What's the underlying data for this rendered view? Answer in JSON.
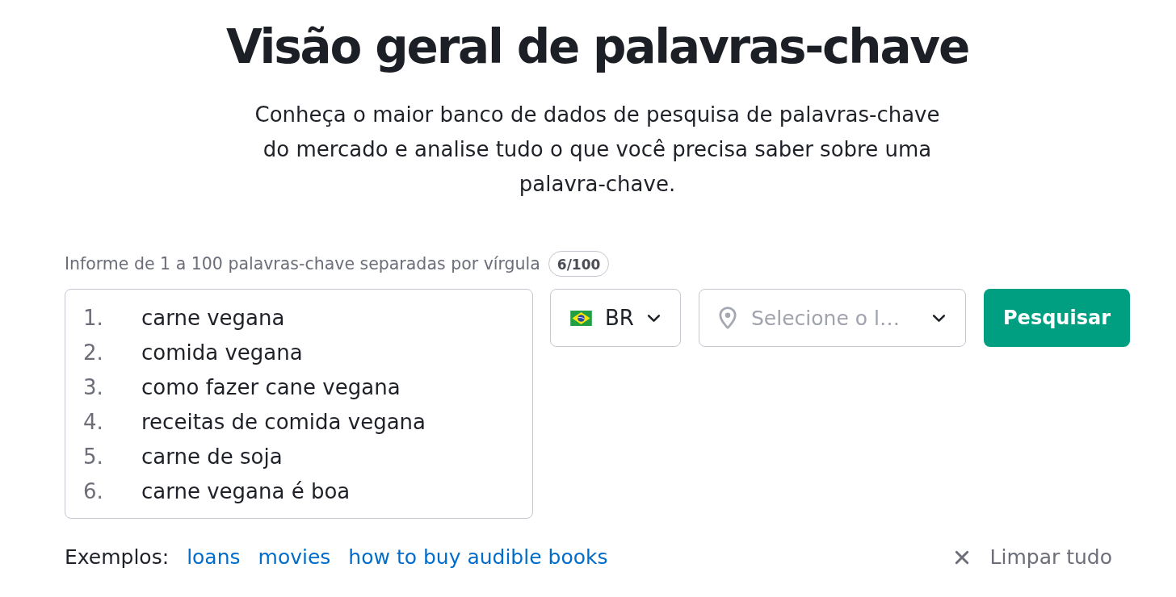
{
  "header": {
    "title": "Visão geral de palavras-chave",
    "subtitle": "Conheça o maior banco de dados de pesquisa de palavras-chave do mercado e analise tudo o que você precisa saber sobre uma palavra-chave."
  },
  "keyword_input": {
    "label": "Informe de 1 a 100 palavras-chave separadas por vírgula",
    "counter": "6/100",
    "lines": [
      {
        "number": "1.",
        "text": "carne vegana"
      },
      {
        "number": "2.",
        "text": "comida vegana"
      },
      {
        "number": "3.",
        "text": "como fazer cane vegana"
      },
      {
        "number": "4.",
        "text": "receitas de comida vegana"
      },
      {
        "number": "5.",
        "text": "carne de soja"
      },
      {
        "number": "6.",
        "text": "carne vegana é boa"
      }
    ]
  },
  "database_select": {
    "value": "BR"
  },
  "location_select": {
    "placeholder": "Selecione o l…"
  },
  "search_button": {
    "label": "Pesquisar"
  },
  "examples": {
    "label": "Exemplos:",
    "links": [
      "loans",
      "movies",
      "how to buy audible books"
    ]
  },
  "clear_button": {
    "label": "Limpar tudo"
  }
}
